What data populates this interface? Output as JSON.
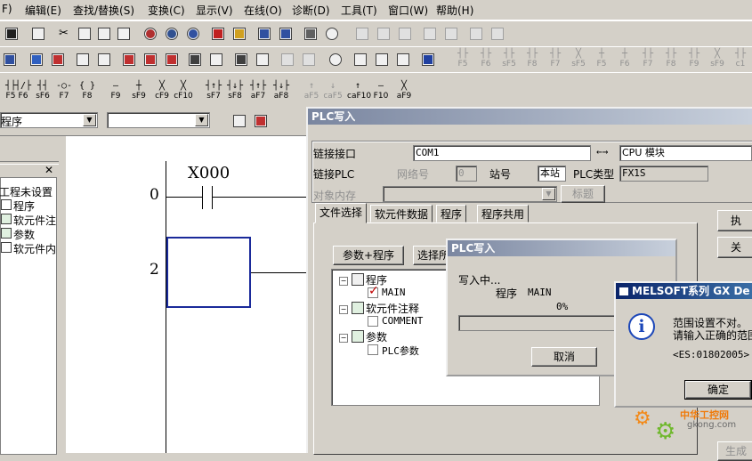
{
  "menu": [
    "F)",
    "编辑(E)",
    "查找/替换(S)",
    "变换(C)",
    "显示(V)",
    "在线(O)",
    "诊断(D)",
    "工具(T)",
    "窗口(W)",
    "帮助(H)"
  ],
  "fkeys_row3": [
    {
      "sym": "┤├",
      "lab": "F5"
    },
    {
      "sym": "┤/├",
      "lab": "F6"
    },
    {
      "sym": "┤┤",
      "lab": "sF6"
    },
    {
      "sym": "-○-",
      "lab": "F7"
    },
    {
      "sym": "{ }",
      "lab": "F8"
    },
    {
      "sym": "—",
      "lab": "F9"
    },
    {
      "sym": "┼",
      "lab": "sF9"
    },
    {
      "sym": "╳",
      "lab": "cF9"
    },
    {
      "sym": "╳",
      "lab": "cF10"
    },
    {
      "sym": "┤↑├",
      "lab": "sF7"
    },
    {
      "sym": "┤↓├",
      "lab": "sF8"
    },
    {
      "sym": "┤↑├",
      "lab": "aF7"
    },
    {
      "sym": "┤↓├",
      "lab": "aF8"
    }
  ],
  "fkeys_row3b": [
    {
      "sym": "↑",
      "lab": "aF5"
    },
    {
      "sym": "↓",
      "lab": "caF5"
    },
    {
      "sym": "↑",
      "lab": "caF10"
    },
    {
      "sym": "—",
      "lab": "F10"
    },
    {
      "sym": "╳",
      "lab": "aF9"
    }
  ],
  "fkeys_row2": [
    "F5",
    "F6",
    "sF5",
    "F8",
    "F7",
    "sF5",
    "F5",
    "F6",
    "F7",
    "F8",
    "F9",
    "sF9",
    "c1"
  ],
  "project_combo": "程序",
  "project_tree": {
    "root": "工程未设置",
    "items": [
      "程序",
      "软元件注",
      "参数",
      "软元件内"
    ]
  },
  "ladder": {
    "contact_label": "X000",
    "step_0": "0",
    "step_2": "2"
  },
  "plc_write": {
    "title": "PLC写入",
    "link_port_label": "链接接口",
    "link_port_value": "COM1",
    "link_arrow": "←→",
    "link_target": "CPU 模块",
    "link_plc_label": "链接PLC",
    "network_label": "网络号",
    "network_value": "0",
    "station_label": "站号",
    "station_value": "本站",
    "plc_type_label": "PLC类型",
    "plc_type_value": "FX1S",
    "target_memory_label": "对象内存",
    "title_btn": "标题",
    "tabs": [
      "文件选择",
      "软元件数据",
      "程序",
      "程序共用"
    ],
    "btn_param_program": "参数+程序",
    "btn_select_all": "选择所",
    "tree": [
      {
        "label": "程序",
        "checked": null
      },
      {
        "label": "MAIN",
        "checked": true
      },
      {
        "label": "软元件注释",
        "checked": null
      },
      {
        "label": "COMMENT",
        "checked": false
      },
      {
        "label": "参数",
        "checked": null
      },
      {
        "label": "PLC参数",
        "checked": false
      }
    ],
    "right_btn1": "执",
    "right_btn2": "关",
    "bottom_btn": "生成"
  },
  "progress_dialog": {
    "title": "PLC写入",
    "writing": "写入中...",
    "program_label": "程序",
    "program_name": "MAIN",
    "percent": "0%",
    "progress_fraction": 0,
    "cancel": "取消"
  },
  "error_dialog": {
    "title": "MELSOFT系列 GX De",
    "line1": "范围设置不对。",
    "line2": "请输入正确的范围",
    "code": "<ES:01802005>",
    "ok": "确定"
  },
  "watermark": {
    "line1": "中华工控网",
    "line2": "gkong.com"
  }
}
